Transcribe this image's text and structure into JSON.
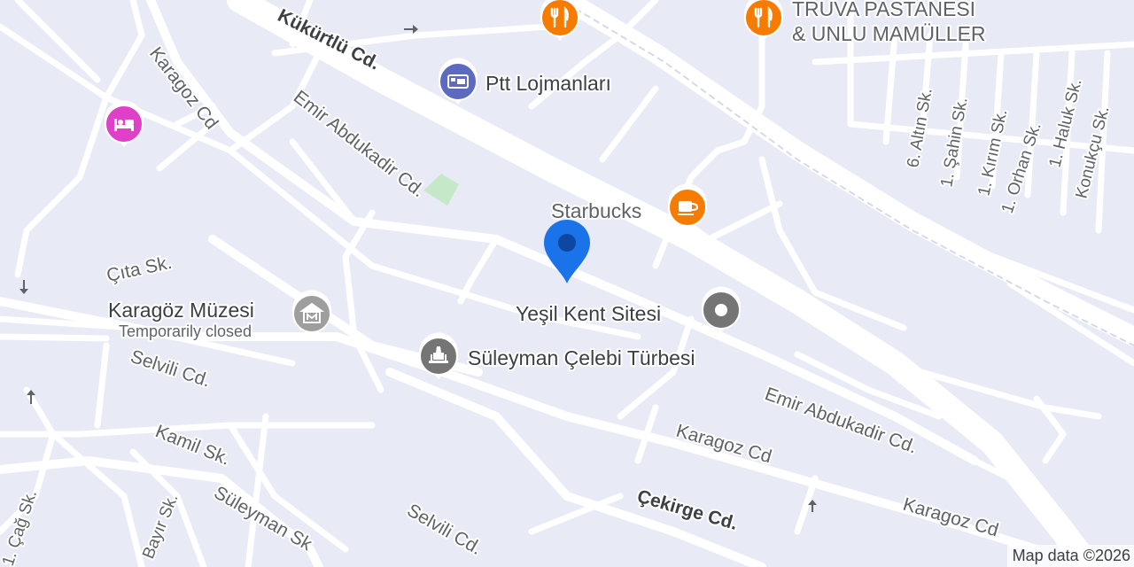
{
  "colors": {
    "background": "#e8eaf6",
    "road": "#ffffff",
    "park": "#c5e8c9",
    "restaurant": "#f57c00",
    "cafe": "#f57c00",
    "hotel": "#e040c8",
    "museum": "#9e9e9e",
    "landmark": "#757575",
    "postal": "#5c6bc0",
    "pin": "#1a73e8"
  },
  "streets": {
    "kukurtlu": "Kükürtlü Cd.",
    "emir_upper": "Emir Abdukadir Cd.",
    "emir_lower": "Emir Abdukadir Cd.",
    "karagoz_left": "Karagoz Cd",
    "karagoz_mid": "Karagoz Cd",
    "karagoz_right": "Karagoz Cd",
    "cita": "Çıta Sk.",
    "selvili": "Selvili Cd.",
    "selvili_lower": "Selvili Cd.",
    "kamil": "Kamil Sk.",
    "suleyman": "Süleyman Sk",
    "bayir": "Bayır Sk.",
    "cag": "1. Çağ Sk.",
    "cekirge": "Çekirge Cd.",
    "altin": "6. Altın Sk.",
    "sahin": "1. Şahin Sk.",
    "kirim": "1. Kırım Sk.",
    "orhan": "1. Orhan Sk.",
    "haluk": "1. Haluk Sk.",
    "konukcu": "Konukçu Sk."
  },
  "pois": {
    "truva_line1": "TRUVA PASTANESİ",
    "truva_line2": "& UNLU MAMÜLLER",
    "ptt": "Ptt Lojmanları",
    "starbucks": "Starbucks",
    "yesil_kent": "Yeşil Kent Sitesi",
    "karagoz_muzesi": "Karagöz Müzesi",
    "karagoz_muzesi_status": "Temporarily closed",
    "suleyman_celebi": "Süleyman Çelebi Türbesi"
  },
  "icons": {
    "restaurant": "restaurant-icon",
    "cafe": "coffee-cup-icon",
    "hotel": "bed-icon",
    "museum": "museum-icon",
    "landmark": "monument-icon",
    "postal": "post-office-icon",
    "generic": "place-dot-icon",
    "location": "location-pin-icon"
  },
  "attribution": "Map data ©2026"
}
